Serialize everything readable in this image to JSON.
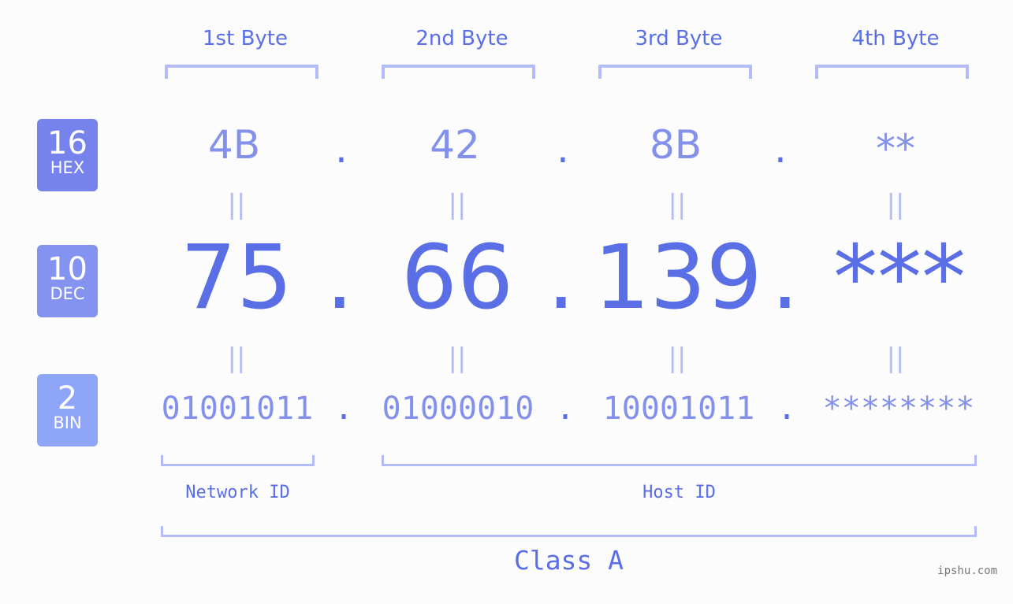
{
  "bytes": [
    {
      "header": "1st Byte",
      "hex": "4B",
      "dec": "75",
      "bin": "01001011"
    },
    {
      "header": "2nd Byte",
      "hex": "42",
      "dec": "66",
      "bin": "01000010"
    },
    {
      "header": "3rd Byte",
      "hex": "8B",
      "dec": "139",
      "bin": "10001011"
    },
    {
      "header": "4th Byte",
      "hex": "**",
      "dec": "***",
      "bin": "********"
    }
  ],
  "separator": ".",
  "equals": "||",
  "badges": {
    "hex": {
      "num": "16",
      "label": "HEX",
      "color": "#7683ec"
    },
    "dec": {
      "num": "10",
      "label": "DEC",
      "color": "#8593f0"
    },
    "bin": {
      "num": "2",
      "label": "BIN",
      "color": "#8fa5f7"
    }
  },
  "segments": {
    "network": "Network ID",
    "host": "Host ID",
    "class": "Class A"
  },
  "watermark": "ipshu.com",
  "colors": {
    "primary": "#5a6ee6",
    "secondary": "#8390ec",
    "bracket": "#b3bcf7"
  }
}
